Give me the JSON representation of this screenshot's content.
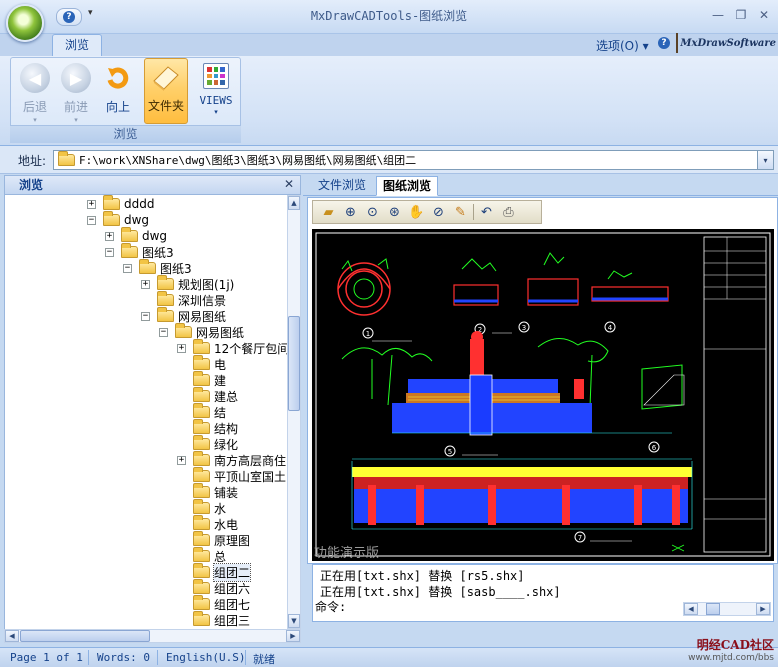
{
  "window": {
    "title": "MxDrawCADTools-图纸浏览",
    "minimize": "—",
    "restore": "❐",
    "close": "✕"
  },
  "qat": {
    "help_glyph": "?",
    "dropdown_glyph": "▾"
  },
  "ribbon": {
    "tabs": [
      {
        "label": "浏览",
        "active": true
      }
    ],
    "options_label": "选项(O) ▾",
    "brand": "MxDrawSoftware",
    "group_label": "浏览",
    "buttons": [
      {
        "label": "后退",
        "icon": "back-arrow-icon",
        "enabled": false,
        "dropdown": "▾"
      },
      {
        "label": "前进",
        "icon": "forward-arrow-icon",
        "enabled": false,
        "dropdown": "▾"
      },
      {
        "label": "向上",
        "icon": "up-refresh-icon",
        "enabled": true
      },
      {
        "label": "文件夹",
        "icon": "folder-icon",
        "enabled": true,
        "active": true
      },
      {
        "label": "VIEWS",
        "icon": "views-grid-icon",
        "enabled": true,
        "dropdown": "▾"
      }
    ]
  },
  "address": {
    "label": "地址:",
    "value": "F:\\work\\XNShare\\dwg\\图纸3\\图纸3\\网易图纸\\网易图纸\\组团二",
    "drop": "▾"
  },
  "left_panel": {
    "title": "浏览",
    "close": "✕",
    "tree": [
      {
        "label": "dddd",
        "level": 0,
        "expander": "+"
      },
      {
        "label": "dwg",
        "level": 0,
        "expander": "−"
      },
      {
        "label": "dwg",
        "level": 1,
        "expander": "+"
      },
      {
        "label": "图纸3",
        "level": 1,
        "expander": "−"
      },
      {
        "label": "图纸3",
        "level": 2,
        "expander": "−"
      },
      {
        "label": "规划图(1j)",
        "level": 3,
        "expander": "+"
      },
      {
        "label": "深圳信景",
        "level": 3,
        "expander": ""
      },
      {
        "label": "网易图纸",
        "level": 3,
        "expander": "−"
      },
      {
        "label": "网易图纸",
        "level": 4,
        "expander": "−"
      },
      {
        "label": "12个餐厅包间",
        "level": 5,
        "expander": "+"
      },
      {
        "label": "电",
        "level": 5,
        "expander": ""
      },
      {
        "label": "建",
        "level": 5,
        "expander": ""
      },
      {
        "label": "建总",
        "level": 5,
        "expander": ""
      },
      {
        "label": "结",
        "level": 5,
        "expander": ""
      },
      {
        "label": "结构",
        "level": 5,
        "expander": ""
      },
      {
        "label": "绿化",
        "level": 5,
        "expander": ""
      },
      {
        "label": "南方高层商住",
        "level": 5,
        "expander": "+"
      },
      {
        "label": "平顶山室国土",
        "level": 5,
        "expander": ""
      },
      {
        "label": "铺装",
        "level": 5,
        "expander": ""
      },
      {
        "label": "水",
        "level": 5,
        "expander": ""
      },
      {
        "label": "水电",
        "level": 5,
        "expander": ""
      },
      {
        "label": "原理图",
        "level": 5,
        "expander": ""
      },
      {
        "label": "总",
        "level": 5,
        "expander": ""
      },
      {
        "label": "组团二",
        "level": 5,
        "expander": "",
        "selected": true
      },
      {
        "label": "组团六",
        "level": 5,
        "expander": ""
      },
      {
        "label": "组团七",
        "level": 5,
        "expander": ""
      },
      {
        "label": "组团三",
        "level": 5,
        "expander": ""
      }
    ]
  },
  "doc_tabs": [
    {
      "label": "文件浏览",
      "active": false
    },
    {
      "label": "图纸浏览",
      "active": true
    }
  ],
  "cad_toolbar": [
    "open-folder-icon",
    "zoom-in-icon",
    "zoom-window-icon",
    "zoom-extents-icon",
    "pan-icon",
    "zoom-previous-icon",
    "pencil-icon",
    "undo-icon",
    "print-icon"
  ],
  "drawing": {
    "watermark": "功能演示版",
    "callouts": [
      "1",
      "2",
      "3",
      "4",
      "5",
      "6",
      "7"
    ],
    "background": "#000000",
    "colors": {
      "red": "#ff3030",
      "green": "#22ff22",
      "blue": "#2244ff",
      "yellow": "#ffff33",
      "cyan": "#33ffff",
      "white": "#ffffff"
    }
  },
  "command": {
    "lines": [
      "正在用[txt.shx] 替换 [rs5.shx]",
      "正在用[txt.shx] 替换 [sasb____.shx]"
    ],
    "prompt": "命令:"
  },
  "status": {
    "page": "Page 1 of 1",
    "words": "Words: 0",
    "lang": "English(U.S)",
    "state": "就绪"
  },
  "corner_logo": {
    "title": "明经CAD社区",
    "url": "www.mjtd.com/bbs"
  }
}
